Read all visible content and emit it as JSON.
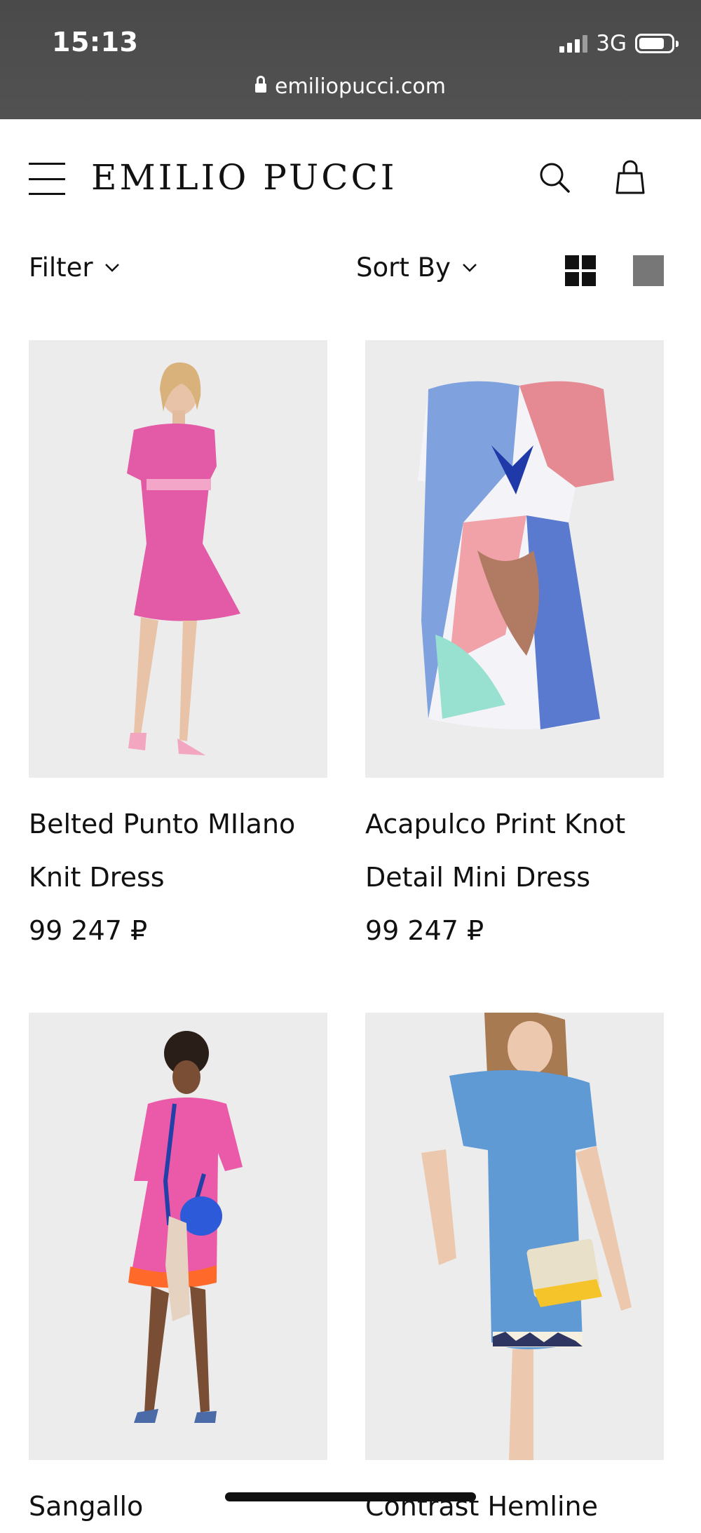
{
  "status_bar": {
    "time": "15:13",
    "network": "3G",
    "battery_level": 0.8,
    "signal_bars": 3
  },
  "browser": {
    "url": "emiliopucci.com"
  },
  "header": {
    "logo": "EMILIO PUCCI",
    "icons": [
      "menu-icon",
      "search-icon",
      "shopping-bag-icon"
    ]
  },
  "controls": {
    "filter_label": "Filter",
    "sort_label": "Sort By",
    "view_icons": [
      "grid-view-icon",
      "single-view-icon"
    ]
  },
  "products": [
    {
      "name_line1": "Belted Punto MIlano",
      "name_line2": "Knit Dress",
      "price": "99 247 ₽",
      "dress_color": "#e35aa6"
    },
    {
      "name_line1": "Acapulco Print Knot",
      "name_line2": "Detail Mini Dress",
      "price": "99 247 ₽",
      "dress_color": "#7fa2df"
    },
    {
      "name_line1": "Sangallo",
      "name_line2": "",
      "price": "",
      "dress_color": "#ea5aa8"
    },
    {
      "name_line1": "Contrast Hemline",
      "name_line2": "",
      "price": "",
      "dress_color": "#5f9ad4"
    }
  ],
  "colors": {
    "status_bar_bg": "#4d4d4d",
    "product_bg": "#ececec",
    "text": "#111111"
  }
}
